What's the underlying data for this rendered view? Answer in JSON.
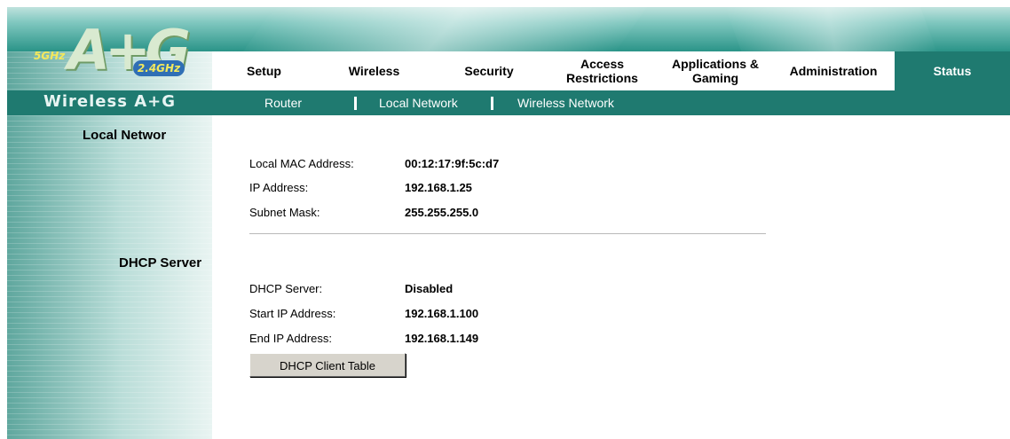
{
  "brand": {
    "logo_text": "A+G",
    "band_5ghz": "5GHz",
    "band_24ghz": "2.4GHz",
    "name": "Wireless A+G"
  },
  "tabs": [
    {
      "label": "Setup",
      "active": false
    },
    {
      "label": "Wireless",
      "active": false
    },
    {
      "label": "Security",
      "active": false
    },
    {
      "label": "Access Restrictions",
      "active": false
    },
    {
      "label": "Applications & Gaming",
      "active": false
    },
    {
      "label": "Administration",
      "active": false
    },
    {
      "label": "Status",
      "active": true
    }
  ],
  "subtabs": [
    {
      "label": "Router"
    },
    {
      "label": "Local Network"
    },
    {
      "label": "Wireless Network"
    }
  ],
  "local_network": {
    "heading": "Local Networ",
    "mac_label": "Local MAC Address:",
    "mac_value": "00:12:17:9f:5c:d7",
    "ip_label": "IP Address:",
    "ip_value": "192.168.1.25",
    "mask_label": "Subnet Mask:",
    "mask_value": "255.255.255.0"
  },
  "dhcp": {
    "heading": "DHCP Server",
    "server_label": "DHCP Server:",
    "server_value": "Disabled",
    "start_label": "Start IP Address:",
    "start_value": "192.168.1.100",
    "end_label": "End IP Address:",
    "end_value": "192.168.1.149",
    "client_table_button": "DHCP Client Table"
  },
  "colors": {
    "nav_teal": "#1f7a70",
    "tab_bg": "#ffffff",
    "button_bg": "#d7d4cc"
  }
}
